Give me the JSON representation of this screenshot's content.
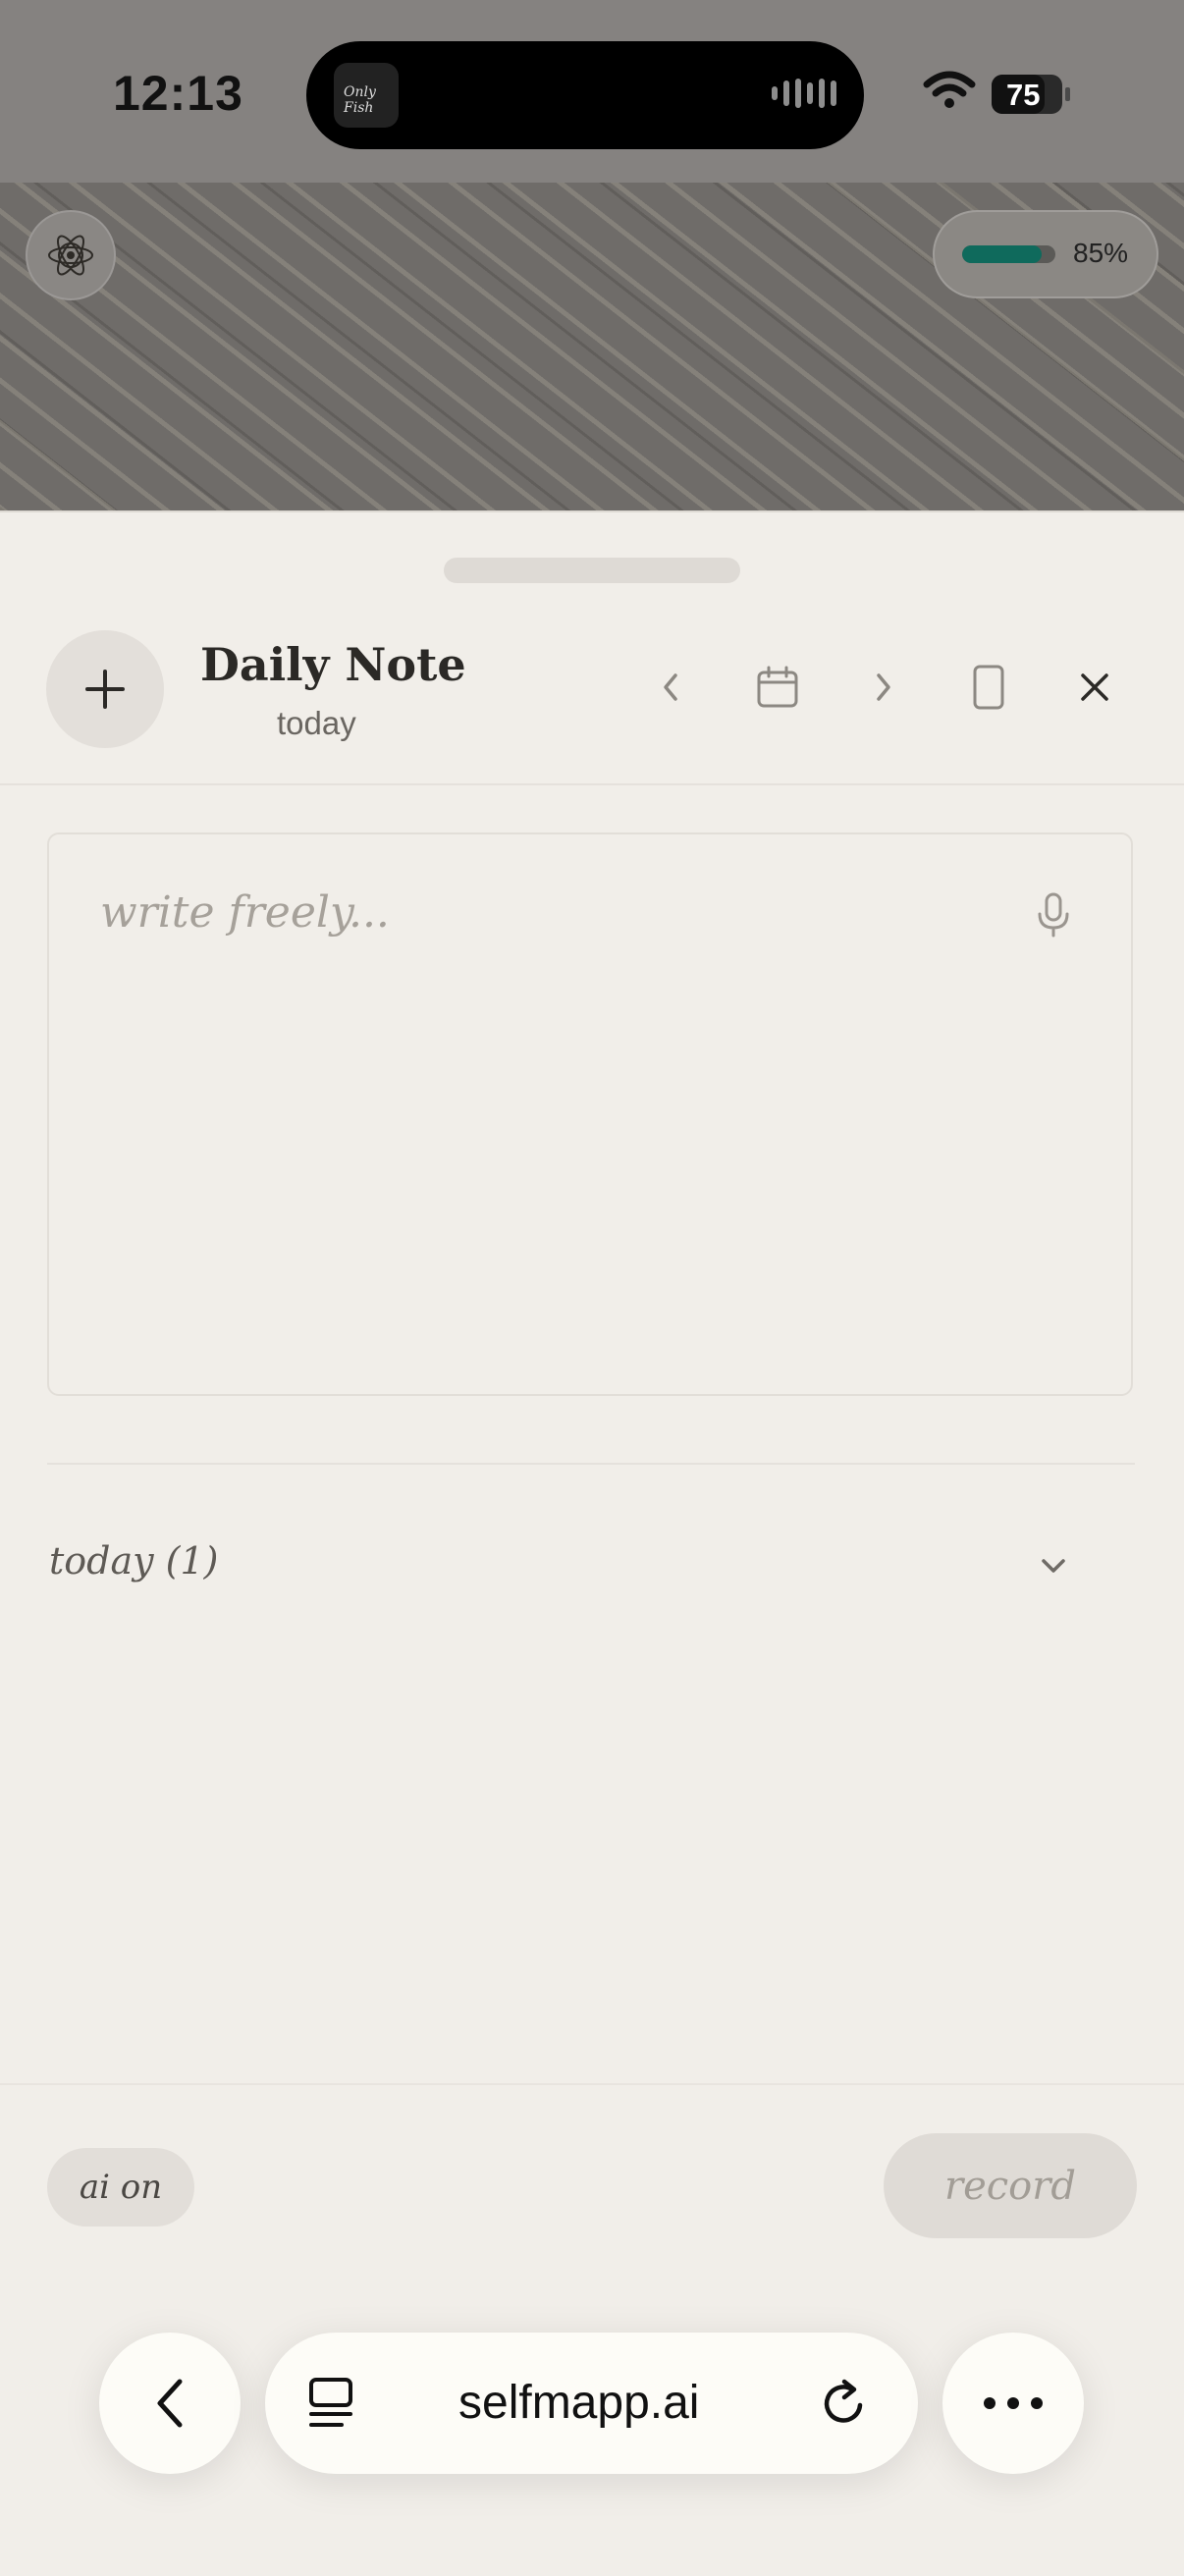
{
  "status_bar": {
    "time": "12:13",
    "battery": "75",
    "island_app_label": "Only Fish"
  },
  "banner": {
    "progress_value": 0.85,
    "progress_label": "85%",
    "progress_color": "#0f6a5c"
  },
  "header": {
    "title": "Daily Note",
    "subtitle": "today",
    "icons": [
      "plus-icon",
      "chevron-left-icon",
      "calendar-icon",
      "chevron-right-icon",
      "page-icon",
      "close-icon"
    ]
  },
  "editor": {
    "placeholder": "write freely...",
    "value": ""
  },
  "entries": {
    "today_label": "today (1)"
  },
  "footer": {
    "ai_toggle": "ai on",
    "record": "record"
  },
  "browser": {
    "url": "selfmapp.ai"
  }
}
